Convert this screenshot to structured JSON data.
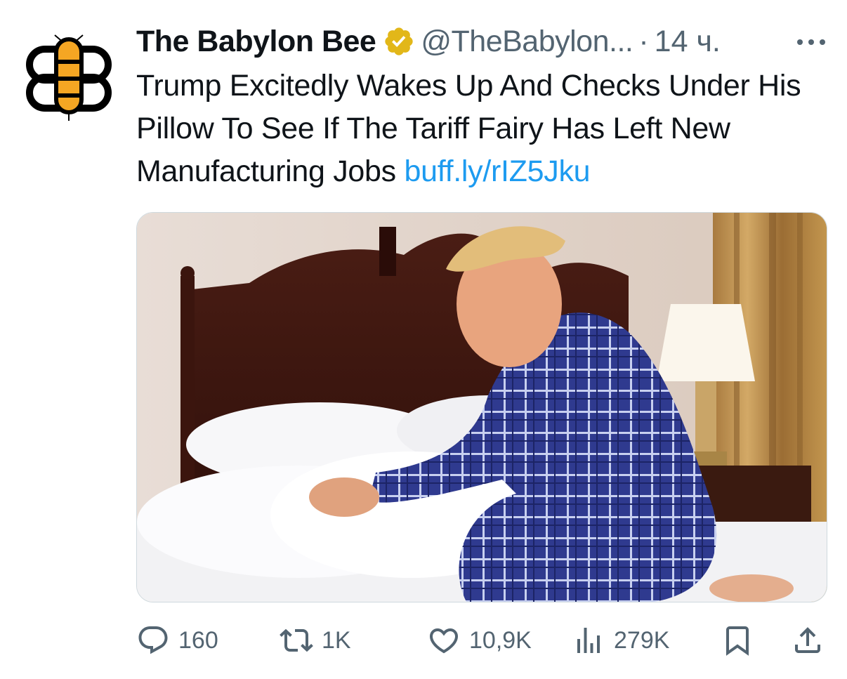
{
  "tweet": {
    "display_name": "The Babylon Bee",
    "handle": "@TheBabylon...",
    "separator": "·",
    "time": "14 ч.",
    "text_main": "Trump Excitedly Wakes Up And Checks Under His Pillow To See If The Tariff Fairy Has Left New Manufacturing Jobs ",
    "link": "buff.ly/rIZ5Jku"
  },
  "actions": {
    "replies": "160",
    "reposts": "1K",
    "likes": "10,9K",
    "views": "279K"
  },
  "icons": {
    "avatar": "babylon-bee-logo",
    "verified": "verified-badge",
    "more": "more-icon",
    "reply": "reply-icon",
    "repost": "repost-icon",
    "like": "heart-icon",
    "views": "views-icon",
    "bookmark": "bookmark-icon",
    "share": "share-icon"
  },
  "colors": {
    "text": "#0f1419",
    "secondary": "#536471",
    "link": "#1d9bf0",
    "verified": "#e2b719",
    "bee_yellow": "#f5a623"
  }
}
